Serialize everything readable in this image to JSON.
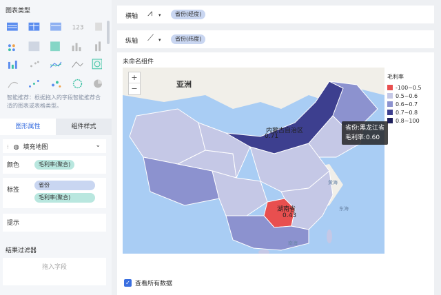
{
  "left_panel": {
    "chart_type_title": "图表类型",
    "hint": "智能推荐：根据拖入的字段智能推荐合适的图表或表格类型。",
    "tabs": [
      "图形属性",
      "组件样式"
    ],
    "map_type": "填充地图",
    "color_label": "颜色",
    "color_field": "毛利率(聚合)",
    "label_label": "标签",
    "label_fields": [
      "省份",
      "毛利率(聚合)"
    ],
    "tooltip_label": "提示",
    "result_filter_title": "结果过滤器",
    "drop_field": "拖入字段"
  },
  "axes": {
    "x_label": "横轴",
    "x_field": "省份(经度)",
    "y_label": "纵轴",
    "y_field": "省份(纬度)"
  },
  "chart": {
    "title": "未命名组件",
    "region_label": "亚洲",
    "show_all": "查看所有数据",
    "zoom_in": "+",
    "zoom_out": "−"
  },
  "legend": {
    "title": "毛利率",
    "items": [
      {
        "label": "-100~0.5",
        "color": "#e84f4f"
      },
      {
        "label": "0.5~0.6",
        "color": "#c5c8e6"
      },
      {
        "label": "0.6~0.7",
        "color": "#8c92cf"
      },
      {
        "label": "0.7~0.8",
        "color": "#3d3f8f"
      },
      {
        "label": "0.8~100",
        "color": "#1d1f5a"
      }
    ]
  },
  "tooltip": {
    "province": "省份:黑龙江省",
    "value": "毛利率:0.60"
  },
  "map_labels": {
    "inner_mongolia": "内蒙古自治区",
    "inner_mongolia_value": "0.71",
    "hunan": "湖南省",
    "hunan_value": "0.43",
    "sea_1": "黄海",
    "sea_2": "东海",
    "sea_3": "南海"
  }
}
